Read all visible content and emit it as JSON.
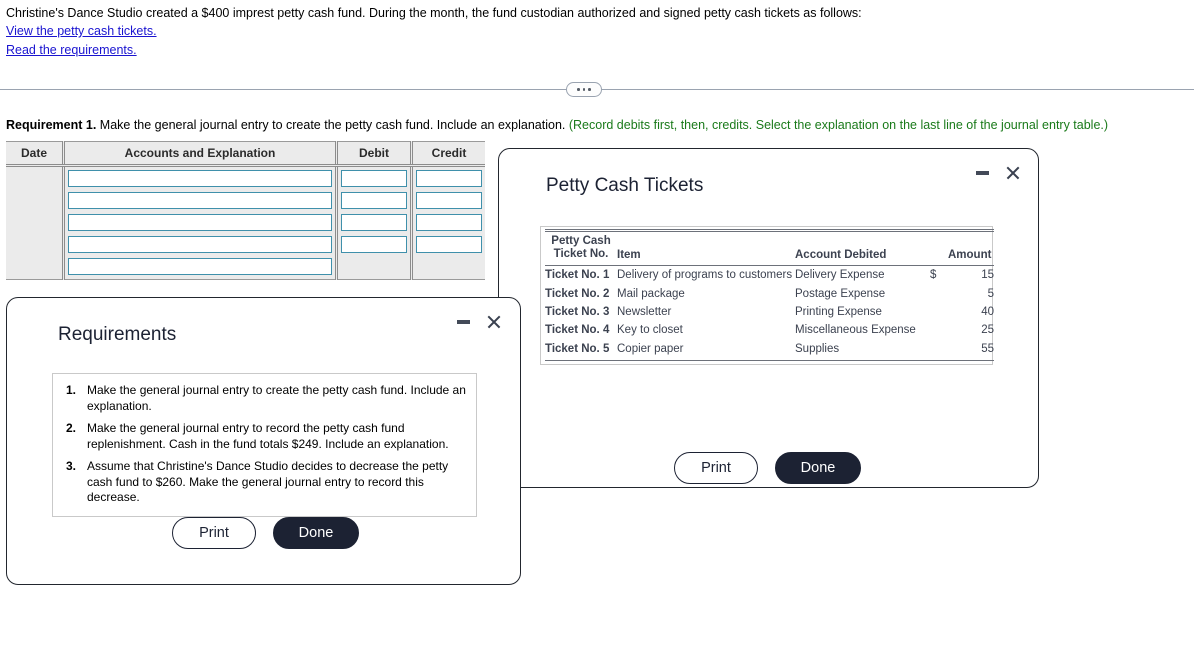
{
  "problem": {
    "statement": "Christine's Dance Studio created a $400 imprest petty cash fund. During the month, the fund custodian authorized and signed petty cash tickets as follows:",
    "link_tickets": "View the petty cash tickets.",
    "link_requirements": "Read the requirements."
  },
  "requirement_line": {
    "label": "Requirement 1.",
    "text": "Make the general journal entry to create the petty cash fund. Include an explanation.",
    "hint": "(Record debits first, then, credits. Select the explanation on the last line of the journal entry table.)",
    "hint_color": "#1a7a1a"
  },
  "journal": {
    "columns": [
      "Date",
      "Accounts and Explanation",
      "Debit",
      "Credit"
    ],
    "rows": [
      {
        "date": "",
        "account": "",
        "debit": "",
        "credit": "",
        "has_amounts": true
      },
      {
        "date": "",
        "account": "",
        "debit": "",
        "credit": "",
        "has_amounts": true
      },
      {
        "date": "",
        "account": "",
        "debit": "",
        "credit": "",
        "has_amounts": true
      },
      {
        "date": "",
        "account": "",
        "debit": "",
        "credit": "",
        "has_amounts": true
      },
      {
        "date": "",
        "account": "",
        "debit": "",
        "credit": "",
        "has_amounts": false
      }
    ]
  },
  "tickets_modal": {
    "title": "Petty Cash Tickets",
    "headers": {
      "no_line1": "Petty Cash",
      "no_line2": "Ticket No.",
      "item": "Item",
      "account": "Account Debited",
      "amount": "Amount"
    },
    "rows": [
      {
        "no": "Ticket No. 1",
        "item": "Delivery of programs to customers",
        "account": "Delivery Expense",
        "currency": "$",
        "amount": "15"
      },
      {
        "no": "Ticket No. 2",
        "item": "Mail package",
        "account": "Postage Expense",
        "currency": "",
        "amount": "5"
      },
      {
        "no": "Ticket No. 3",
        "item": "Newsletter",
        "account": "Printing Expense",
        "currency": "",
        "amount": "40"
      },
      {
        "no": "Ticket No. 4",
        "item": "Key to closet",
        "account": "Miscellaneous Expense",
        "currency": "",
        "amount": "25"
      },
      {
        "no": "Ticket No. 5",
        "item": "Copier paper",
        "account": "Supplies",
        "currency": "",
        "amount": "55"
      }
    ],
    "buttons": {
      "print": "Print",
      "done": "Done"
    }
  },
  "requirements_modal": {
    "title": "Requirements",
    "items": [
      {
        "num": "1.",
        "text": "Make the general journal entry to create the petty cash fund. Include an explanation."
      },
      {
        "num": "2.",
        "text": "Make the general journal entry to record the petty cash fund replenishment. Cash in the fund totals $249. Include an explanation."
      },
      {
        "num": "3.",
        "text": "Assume that Christine's Dance Studio decides to decrease the petty cash fund to $260. Make the general journal entry to record this decrease."
      }
    ],
    "buttons": {
      "print": "Print",
      "done": "Done"
    }
  }
}
